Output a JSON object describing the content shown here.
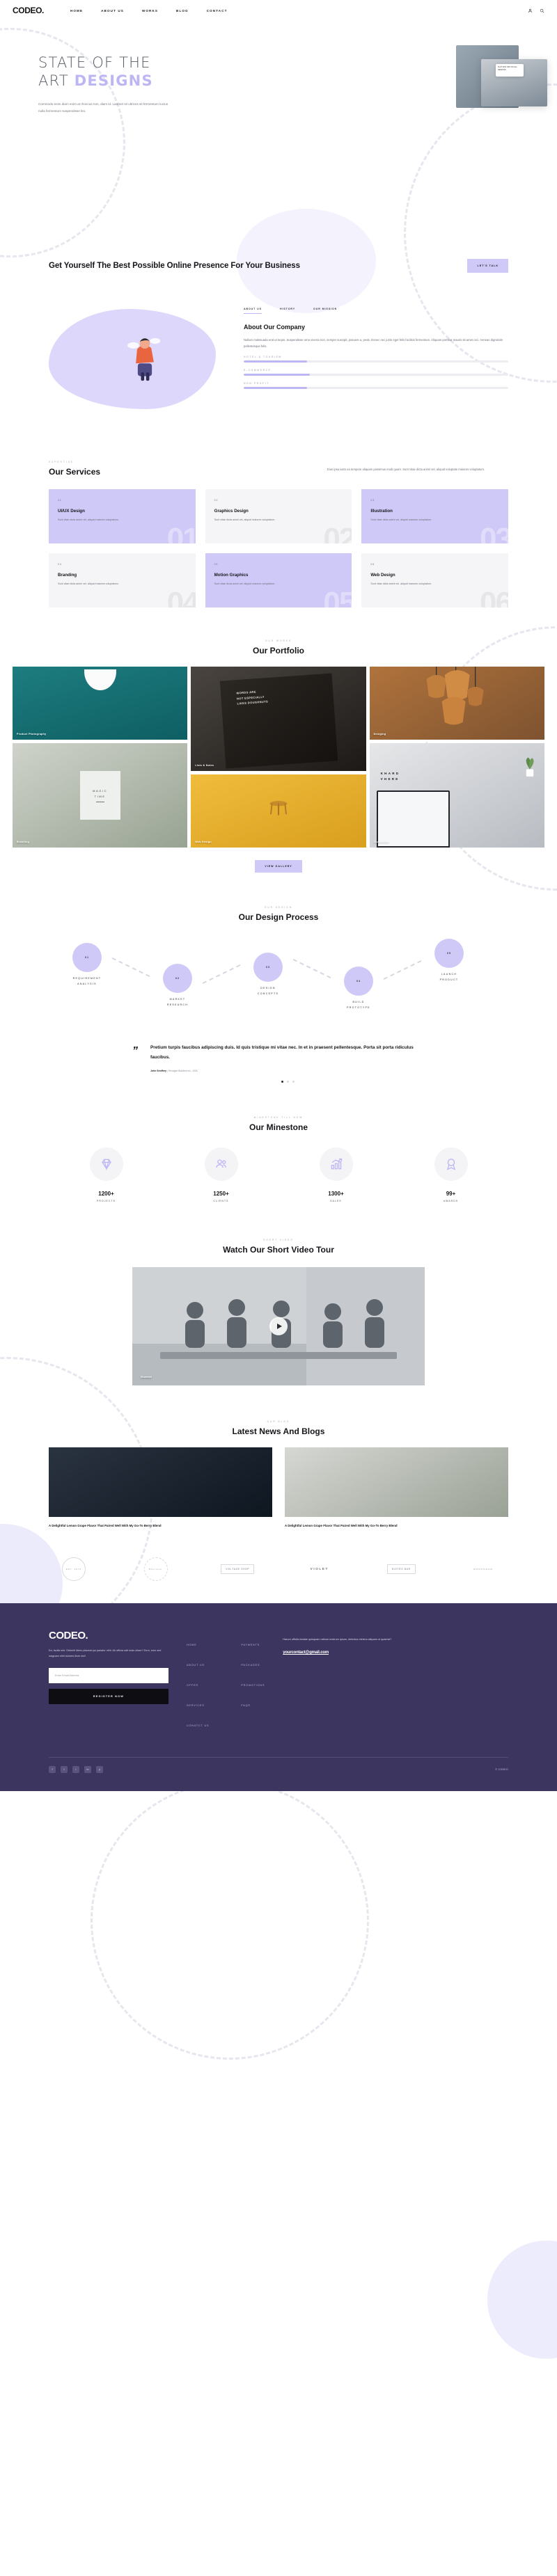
{
  "brand": {
    "logo": "CODEO.",
    "accent": "#cfc9f8",
    "footer_bg": "#3c3560"
  },
  "header": {
    "nav": [
      {
        "label": "HOME"
      },
      {
        "label": "ABOUT US"
      },
      {
        "label": "WORKS"
      },
      {
        "label": "BLOG"
      },
      {
        "label": "CONTACT"
      }
    ],
    "icons": [
      {
        "name": "user-icon"
      },
      {
        "name": "search-icon"
      }
    ]
  },
  "hero": {
    "title_line1": "STATE OF THE",
    "title_line2_plain": "ART ",
    "title_line2_accent": "DESIGNS",
    "subtitle": "Commodo enim diam enim at rhoncus non, diam id. Laoreet sit ultrices sit fermentum luctus nulla fermentum suspendisse leo.",
    "card_text": "FLAT 20% OFF ON ALL DESIGNS"
  },
  "cta": {
    "heading": "Get Yourself The Best Possible Online Presence For Your Business",
    "button": "LET'S TALK"
  },
  "about": {
    "tabs": [
      {
        "label": "ABOUT US",
        "active": true
      },
      {
        "label": "HISTORY",
        "active": false
      },
      {
        "label": "OUR MISSION",
        "active": false
      }
    ],
    "heading": "About Our Company",
    "paragraph": "Nullam malesuada erat ut turpis. Suspendisse urna viverra non, semper suscipit, posuere a, pede. Donec nec justo eget felis facilisis fermentum. Aliquam porttitor mauris sit amet orci. Aenean dignissim pellentesque felis.",
    "skills": [
      {
        "label": "HOTEL & TOURISM",
        "value": 24
      },
      {
        "label": "E-COMMERCE",
        "value": 25
      },
      {
        "label": "NON PROFIT",
        "value": 24
      }
    ]
  },
  "services": {
    "eyebrow": "EXPERTISE",
    "title": "Our Services",
    "description": "Eius ipsa iusto ea tempore aliquam possimus modi quam. Sunt vitae dicta animi vel, aliquid voluptate maiores voluptatum.",
    "cards": [
      {
        "num": "01",
        "name": "UI/UX Design",
        "text": "Sunt vitae dicta animi vel, aliquid maiores voluptatum.",
        "highlight": true
      },
      {
        "num": "02",
        "name": "Graphics Design",
        "text": "Sunt vitae dicta animi vel, aliquid maiores voluptatum.",
        "highlight": false
      },
      {
        "num": "03",
        "name": "Illustration",
        "text": "Sunt vitae dicta animi vel, aliquid maiores voluptatum.",
        "highlight": true
      },
      {
        "num": "04",
        "name": "Branding",
        "text": "Sunt vitae dicta animi vel, aliquid maiores voluptatum.",
        "highlight": false
      },
      {
        "num": "05",
        "name": "Motion Graphics",
        "text": "Sunt vitae dicta animi vel, aliquid maiores voluptatum.",
        "highlight": true
      },
      {
        "num": "06",
        "name": "Web Design",
        "text": "Sunt vitae dicta animi vel, aliquid maiores voluptatum.",
        "highlight": false
      }
    ]
  },
  "portfolio": {
    "eyebrow": "OUR WORKS",
    "title": "Our Portfolio",
    "items": [
      {
        "label": "Product Photography"
      },
      {
        "label": "Lists & Notes"
      },
      {
        "label": "Desiging"
      },
      {
        "label": "Branding"
      },
      {
        "label": "Web Design"
      },
      {
        "label": "Illustration"
      }
    ],
    "inner_text": {
      "magic": "MAGIC\nTIME",
      "khard": "KHARD\nVHERE",
      "book": "WORDS ARE NOT ESPECIALLY\nLIKES DOUGHNUTS"
    },
    "button": "VIEW GALLERY"
  },
  "process": {
    "eyebrow": "OUR DESIGN",
    "title": "Our Design Process",
    "steps": [
      {
        "num": "01",
        "label": "REQUIREMENT\nANALYSIS"
      },
      {
        "num": "02",
        "label": "MARKET\nRESEARCH"
      },
      {
        "num": "03",
        "label": "DESIGN\nCONCEPTS"
      },
      {
        "num": "04",
        "label": "BUILD\nPROTOTYPE"
      },
      {
        "num": "05",
        "label": "LAUNCH\nPRODUCT"
      }
    ]
  },
  "testimonial": {
    "quote": "Pretium turpis faucibus adipiscing duis. Id quis tristique mi vitae nec. In et in praesent pellentesque. Porta sit porta ridiculus faucibus.",
    "author": "John Geoffrey",
    "company": "Hexagon Builders inc., USA",
    "slide_count": 3,
    "active_slide": 1
  },
  "milestone": {
    "eyebrow": "MINESTONE TILL NOW",
    "title": "Our Minestone",
    "items": [
      {
        "icon": "diamond-icon",
        "number": "1200+",
        "label": "PROJECTS"
      },
      {
        "icon": "users-icon",
        "number": "1250+",
        "label": "CLIENTS"
      },
      {
        "icon": "chart-growth-icon",
        "number": "1300+",
        "label": "SALES"
      },
      {
        "icon": "award-icon",
        "number": "99+",
        "label": "AWARDS"
      }
    ]
  },
  "video": {
    "eyebrow": "SHORT VIDEO",
    "title": "Watch Our Short Video Tour",
    "badge": "Showreel"
  },
  "blog": {
    "eyebrow": "OUR BLOG",
    "title": "Latest News And Blogs",
    "posts": [
      {
        "title": "A Delightful Lemon Grape Flavor That Paired Well With My Go-To Berry Blend"
      },
      {
        "title": "A Delightful Lemon Grape Flavor That Paired Well With My Go-To Berry Blend"
      }
    ]
  },
  "clients": {
    "logos": [
      {
        "name": "circle-badge-logo",
        "text": "EST. 1976"
      },
      {
        "name": "script-logo",
        "text": "Boutique"
      },
      {
        "name": "vintage-shop-logo",
        "text": "VIN-TAGE SHOP"
      },
      {
        "name": "violet-logo",
        "text": "VIOLET"
      },
      {
        "name": "bistro-bar-logo",
        "text": "BISTRO BAR"
      },
      {
        "name": "striped-logo",
        "text": "MONOGRAM"
      }
    ]
  },
  "footer": {
    "logo": "CODEO.",
    "description": "Ea, facilis sint. Deleniti libero placeat qui pariatur nihil. Ab officia odit iusto ullam? Error, eum sed magnam nihil dolores illum nisi!",
    "email_placeholder": "Enter Email Address",
    "register_button": "REGISTER NOW",
    "links_col1": [
      {
        "label": "HOME"
      },
      {
        "label": "ABOUT US"
      },
      {
        "label": "OFFER"
      },
      {
        "label": "SERVICES"
      },
      {
        "label": "CONATCT US"
      }
    ],
    "links_col2": [
      {
        "label": "PAYMENTS"
      },
      {
        "label": "PACKAGES"
      },
      {
        "label": "PROMOTIONS"
      },
      {
        "label": "FAQS"
      }
    ],
    "right_text": "Harum officiis beatae quisquam ratione nostrum ipsum, delectus minima aliquam ut quaerat?",
    "email": "yourcontact@gmail.com",
    "socials": [
      {
        "name": "facebook-icon",
        "glyph": "f"
      },
      {
        "name": "twitter-icon",
        "glyph": "t"
      },
      {
        "name": "instagram-icon",
        "glyph": "i"
      },
      {
        "name": "linkedin-icon",
        "glyph": "in"
      },
      {
        "name": "youtube-icon",
        "glyph": "y"
      }
    ],
    "copyright": "© CODEO"
  }
}
